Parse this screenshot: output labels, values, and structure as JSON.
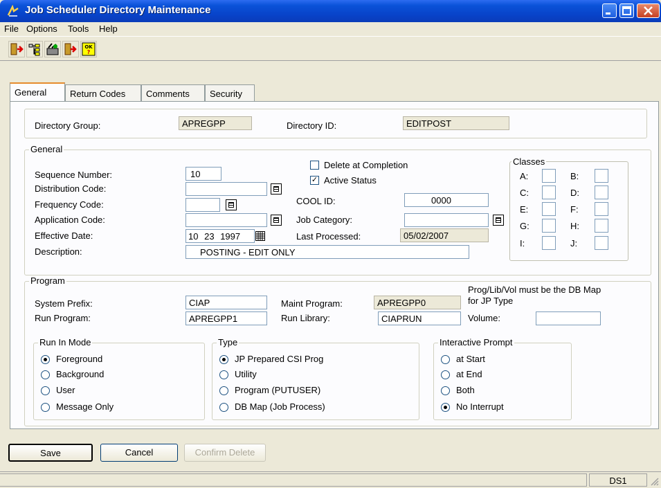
{
  "window": {
    "title": "Job Scheduler Directory Maintenance"
  },
  "menu": [
    "File",
    "Options",
    "Tools",
    "Help"
  ],
  "toolbar": [
    "exit-icon",
    "tree-icon",
    "tools-icon",
    "run-icon",
    "ok-help-icon"
  ],
  "tabs": [
    "General",
    "Return Codes",
    "Comments",
    "Security"
  ],
  "header": {
    "dir_group_label": "Directory Group:",
    "dir_group_value": "APREGPP",
    "dir_id_label": "Directory ID:",
    "dir_id_value": "EDITPOST"
  },
  "general": {
    "title": "General",
    "seq_label": "Sequence Number:",
    "seq_value": "10",
    "dist_label": "Distribution Code:",
    "dist_value": "",
    "freq_label": "Frequency Code:",
    "freq_value": "",
    "app_label": "Application Code:",
    "app_value": "",
    "eff_label": "Effective Date:",
    "eff_month": "10",
    "eff_day": "23",
    "eff_year": "1997",
    "desc_label": "Description:",
    "desc_value": "POSTING - EDIT ONLY",
    "delete_label": "Delete at Completion",
    "active_label": "Active Status",
    "cool_label": "COOL ID:",
    "cool_value": "0000",
    "jobcat_label": "Job Category:",
    "jobcat_value": "",
    "last_label": "Last Processed:",
    "last_value": "05/02/2007"
  },
  "classes": {
    "title": "Classes",
    "items": [
      "A:",
      "B:",
      "C:",
      "D:",
      "E:",
      "F:",
      "G:",
      "H:",
      "I:",
      "J:"
    ]
  },
  "program": {
    "title": "Program",
    "prefix_label": "System Prefix:",
    "prefix_value": "CIAP",
    "maint_label": "Maint Program:",
    "maint_value": "APREGPP0",
    "note": "Prog/Lib/Vol must be the DB Map for JP Type",
    "run_label": "Run Program:",
    "run_value": "APREGPP1",
    "lib_label": "Run Library:",
    "lib_value": "CIAPRUN",
    "vol_label": "Volume:",
    "vol_value": ""
  },
  "run_mode": {
    "title": "Run In Mode",
    "options": [
      "Foreground",
      "Background",
      "User",
      "Message Only"
    ],
    "selected": 0
  },
  "type": {
    "title": "Type",
    "options": [
      "JP Prepared CSI Prog",
      "Utility",
      "Program (PUTUSER)",
      "DB Map (Job Process)"
    ],
    "selected": 0
  },
  "prompt": {
    "title": "Interactive Prompt",
    "options": [
      "at Start",
      "at End",
      "Both",
      "No Interrupt"
    ],
    "selected": 3
  },
  "buttons": {
    "save": "Save",
    "cancel": "Cancel",
    "confirm_delete": "Confirm Delete"
  },
  "status": {
    "ds": "DS1"
  }
}
